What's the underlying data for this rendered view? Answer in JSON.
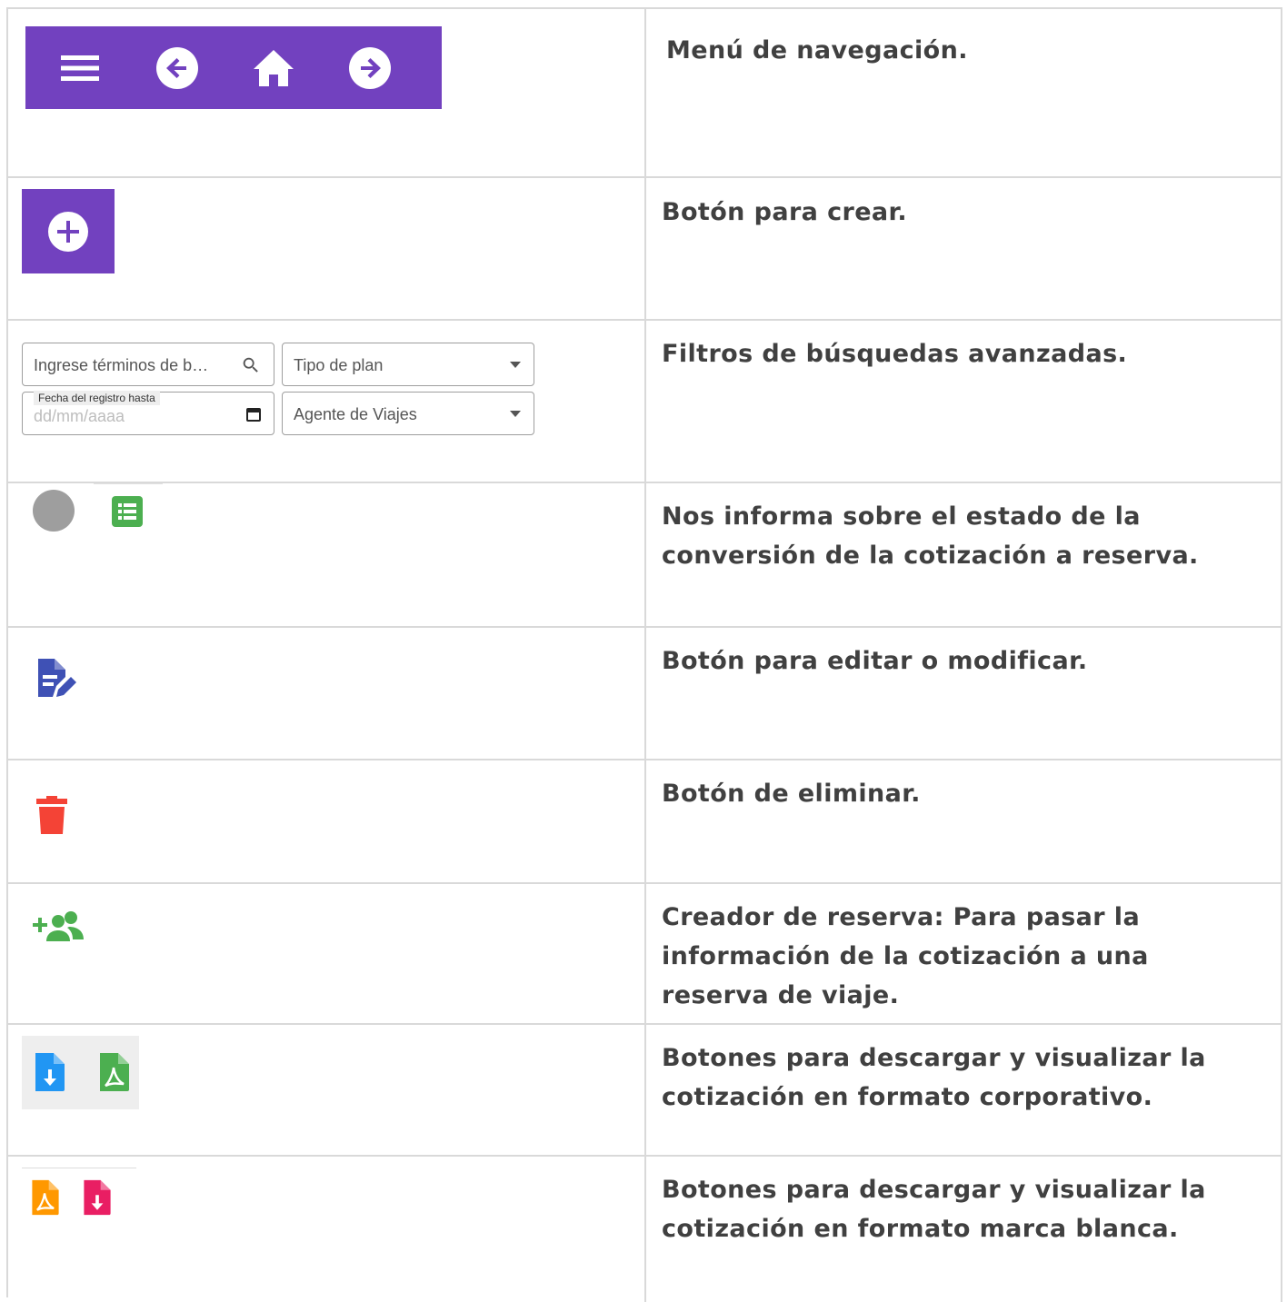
{
  "rows": [
    {
      "description": "Menú de navegación."
    },
    {
      "description": "Botón para crear."
    },
    {
      "description": "Filtros de búsquedas avanzadas."
    },
    {
      "description": "Nos informa sobre el estado de la conversión de la cotización a reserva."
    },
    {
      "description": "Botón para editar o modificar."
    },
    {
      "description": "Botón de eliminar."
    },
    {
      "description": "Creador de reserva: Para pasar la información de la cotización a una reserva de viaje."
    },
    {
      "description": "Botones para descargar y visualizar la cotización en formato corporativo."
    },
    {
      "description": "Botones para descargar y visualizar la cotización en formato marca blanca."
    }
  ],
  "filters": {
    "search_placeholder": "Ingrese términos de b…",
    "plan_type": "Tipo de plan",
    "date_label": "Fecha del registro hasta",
    "date_placeholder": "dd/mm/aaaa",
    "agent": "Agente de Viajes"
  },
  "colors": {
    "accent_purple": "#7241bf",
    "status_grey": "#9e9e9e",
    "green": "#4caf50",
    "edit_blue": "#3f51b5",
    "delete_red": "#f44336",
    "download_blue": "#2196f3",
    "orange": "#ff9800",
    "pink": "#e91e63"
  },
  "icons": [
    "menu-icon",
    "arrow-back-icon",
    "home-icon",
    "arrow-forward-icon",
    "add-circle-icon",
    "search-icon",
    "dropdown-arrow-icon",
    "calendar-icon",
    "status-circle-icon",
    "list-icon",
    "edit-document-icon",
    "trash-icon",
    "add-group-icon",
    "file-download-icon",
    "pdf-icon"
  ]
}
